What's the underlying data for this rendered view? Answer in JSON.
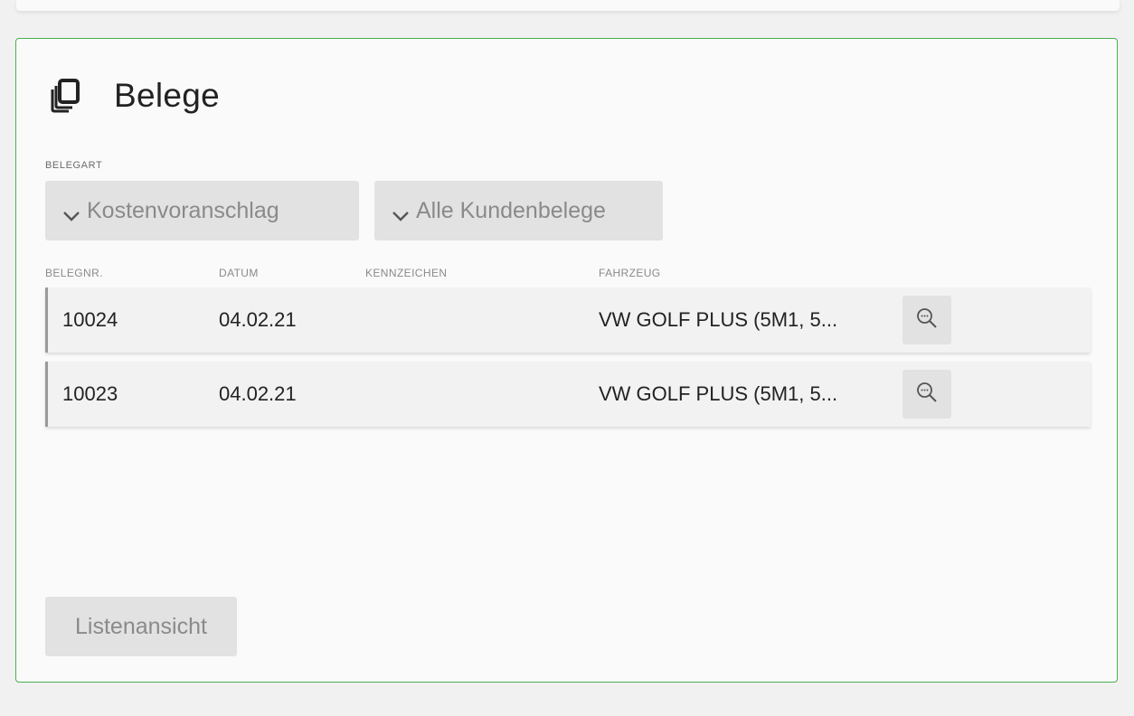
{
  "header": {
    "title": "Belege",
    "icon": "copy-documents-icon"
  },
  "filters": {
    "label": "BELEGART",
    "document_type": "Kostenvoranschlag",
    "scope": "Alle Kundenbelege"
  },
  "table": {
    "columns": [
      "BELEGNR.",
      "DATUM",
      "KENNZEICHEN",
      "FAHRZEUG"
    ],
    "rows": [
      {
        "number": "10024",
        "date": "04.02.21",
        "plate": "",
        "vehicle": "VW GOLF PLUS (5M1, 5..."
      },
      {
        "number": "10023",
        "date": "04.02.21",
        "plate": "",
        "vehicle": "VW GOLF PLUS (5M1, 5..."
      }
    ]
  },
  "footer": {
    "list_view_label": "Listenansicht"
  },
  "colors": {
    "card_border": "#4caf50",
    "button_bg": "#e2e2e2",
    "muted_text": "#8a8a8a"
  }
}
